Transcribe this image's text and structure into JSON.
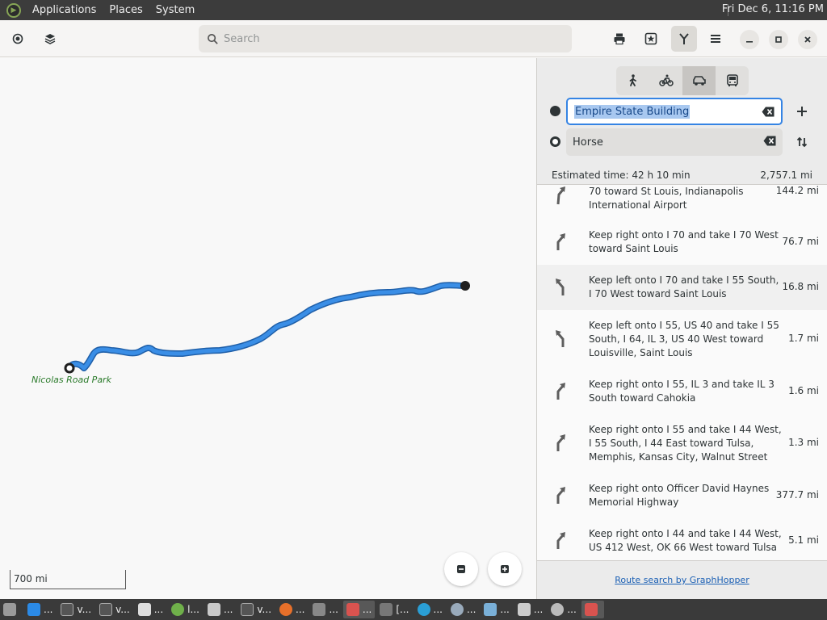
{
  "topbar": {
    "menus": [
      "Applications",
      "Places",
      "System"
    ],
    "clock": "Fri Dec  6, 11:16 PM"
  },
  "header": {
    "search_placeholder": "Search"
  },
  "map": {
    "place_label": "Nicolas Road Park",
    "scale_label": "700 mi",
    "route_color": "#3a8ee6"
  },
  "panel": {
    "from": "Empire State Building",
    "to": "Horse",
    "estimated_time": "Estimated time: 42 h 10 min",
    "total_distance": "2,757.1 mi",
    "steps": [
      {
        "text": "70 toward St Louis, Indianapolis International Airport",
        "distance": "144.2 mi",
        "icon": "arrow-slight-right-icon"
      },
      {
        "text": "Keep right onto I 70 and take I 70 West toward Saint Louis",
        "distance": "76.7 mi",
        "icon": "arrow-keep-right-icon"
      },
      {
        "text": "Keep left onto I 70 and take I 55 South, I 70 West toward Saint Louis",
        "distance": "16.8 mi",
        "icon": "arrow-keep-left-icon"
      },
      {
        "text": "Keep left onto I 55, US 40 and take I 55 South, I 64, IL 3, US 40 West toward Louisville, Saint Louis",
        "distance": "1.7 mi",
        "icon": "arrow-keep-left-icon"
      },
      {
        "text": "Keep right onto I 55, IL 3 and take IL 3 South toward Cahokia",
        "distance": "1.6 mi",
        "icon": "arrow-keep-right-icon"
      },
      {
        "text": "Keep right onto I 55 and take I 44 West, I 55 South, I 44 East toward Tulsa, Memphis, Kansas City, Walnut Street",
        "distance": "1.3 mi",
        "icon": "arrow-keep-right-icon"
      },
      {
        "text": "Keep right onto Officer David Haynes Memorial Highway",
        "distance": "377.7 mi",
        "icon": "arrow-keep-right-icon"
      },
      {
        "text": "Keep right onto I 44 and take I 44 West, US 412 West, OK 66 West toward Tulsa",
        "distance": "5.1 mi",
        "icon": "arrow-keep-right-icon"
      }
    ],
    "footer_link": "Route search by GraphHopper"
  },
  "taskbar": {
    "items": [
      "...",
      "v...",
      "v...",
      "...",
      "l...",
      "...",
      "v...",
      "...",
      "...",
      "[...",
      "...",
      "[...",
      "...",
      "...",
      "...",
      "...",
      "...",
      "...",
      ""
    ]
  }
}
